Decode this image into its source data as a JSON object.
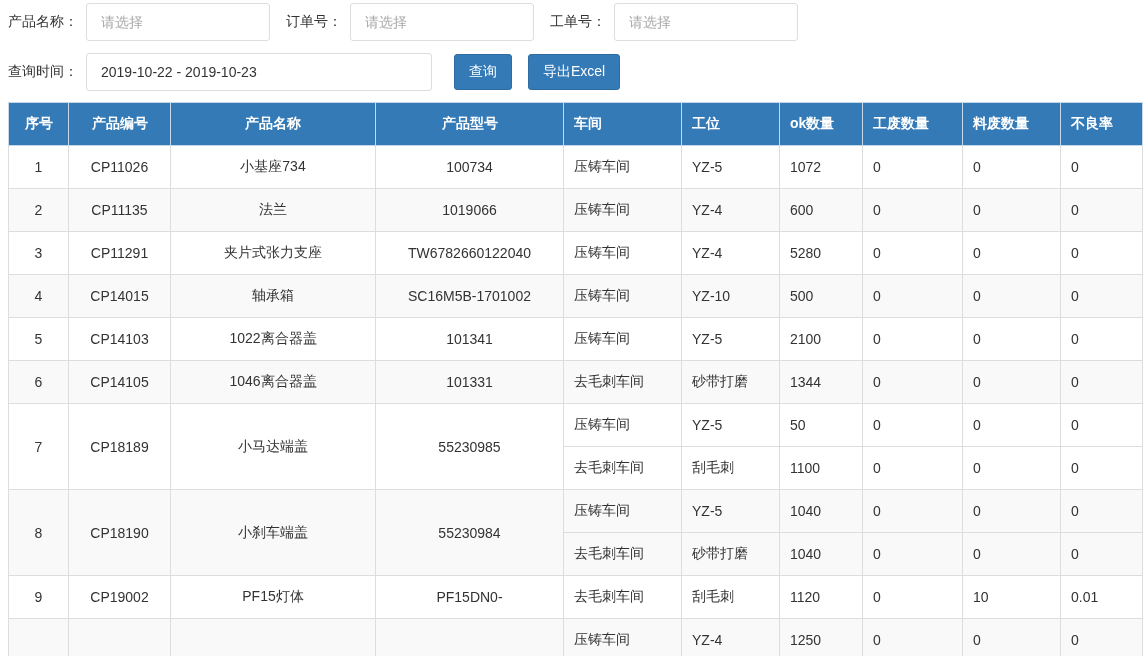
{
  "filters": [
    {
      "label": "产品名称：",
      "placeholder": "请选择"
    },
    {
      "label": "订单号：",
      "placeholder": "请选择"
    },
    {
      "label": "工单号：",
      "placeholder": "请选择"
    }
  ],
  "date_filter": {
    "label": "查询时间：",
    "value": "2019-10-22 - 2019-10-23"
  },
  "buttons": [
    "查询",
    "导出Excel"
  ],
  "table": {
    "columns": [
      "序号",
      "产品编号",
      "产品名称",
      "产品型号",
      "车间",
      "工位",
      "ok数量",
      "工废数量",
      "料废数量",
      "不良率"
    ],
    "rows": [
      {
        "no": "1",
        "code": "CP11026",
        "name": "小基座734",
        "model": "100734",
        "stations": [
          {
            "workshop": "压铸车间",
            "station": "YZ-5",
            "ok": "1072",
            "work_scrap": "0",
            "material_scrap": "0",
            "defect_rate": "0"
          }
        ]
      },
      {
        "no": "2",
        "code": "CP11135",
        "name": "法兰",
        "model": "1019066",
        "stations": [
          {
            "workshop": "压铸车间",
            "station": "YZ-4",
            "ok": "600",
            "work_scrap": "0",
            "material_scrap": "0",
            "defect_rate": "0"
          }
        ]
      },
      {
        "no": "3",
        "code": "CP11291",
        "name": "夹片式张力支座",
        "model": "TW6782660122040",
        "stations": [
          {
            "workshop": "压铸车间",
            "station": "YZ-4",
            "ok": "5280",
            "work_scrap": "0",
            "material_scrap": "0",
            "defect_rate": "0"
          }
        ]
      },
      {
        "no": "4",
        "code": "CP14015",
        "name": "轴承箱",
        "model": "SC16M5B-1701002",
        "stations": [
          {
            "workshop": "压铸车间",
            "station": "YZ-10",
            "ok": "500",
            "work_scrap": "0",
            "material_scrap": "0",
            "defect_rate": "0"
          }
        ]
      },
      {
        "no": "5",
        "code": "CP14103",
        "name": "1022离合器盖",
        "model": "101341",
        "stations": [
          {
            "workshop": "压铸车间",
            "station": "YZ-5",
            "ok": "2100",
            "work_scrap": "0",
            "material_scrap": "0",
            "defect_rate": "0"
          }
        ]
      },
      {
        "no": "6",
        "code": "CP14105",
        "name": "1046离合器盖",
        "model": "101331",
        "stations": [
          {
            "workshop": "去毛刺车间",
            "station": "砂带打磨",
            "ok": "1344",
            "work_scrap": "0",
            "material_scrap": "0",
            "defect_rate": "0"
          }
        ]
      },
      {
        "no": "7",
        "code": "CP18189",
        "name": "小马达端盖",
        "model": "55230985",
        "stations": [
          {
            "workshop": "压铸车间",
            "station": "YZ-5",
            "ok": "50",
            "work_scrap": "0",
            "material_scrap": "0",
            "defect_rate": "0"
          },
          {
            "workshop": "去毛刺车间",
            "station": "刮毛刺",
            "ok": "1100",
            "work_scrap": "0",
            "material_scrap": "0",
            "defect_rate": "0"
          }
        ]
      },
      {
        "no": "8",
        "code": "CP18190",
        "name": "小刹车端盖",
        "model": "55230984",
        "stations": [
          {
            "workshop": "压铸车间",
            "station": "YZ-5",
            "ok": "1040",
            "work_scrap": "0",
            "material_scrap": "0",
            "defect_rate": "0"
          },
          {
            "workshop": "去毛刺车间",
            "station": "砂带打磨",
            "ok": "1040",
            "work_scrap": "0",
            "material_scrap": "0",
            "defect_rate": "0"
          }
        ]
      },
      {
        "no": "9",
        "code": "CP19002",
        "name": "PF15灯体",
        "model": "PF15DN0-",
        "stations": [
          {
            "workshop": "去毛刺车间",
            "station": "刮毛刺",
            "ok": "1120",
            "work_scrap": "0",
            "material_scrap": "10",
            "defect_rate": "0.01"
          }
        ]
      },
      {
        "stations": [
          {
            "workshop": "压铸车间",
            "station": "YZ-4",
            "ok": "1250",
            "work_scrap": "0",
            "material_scrap": "0",
            "defect_rate": "0"
          }
        ]
      }
    ]
  }
}
